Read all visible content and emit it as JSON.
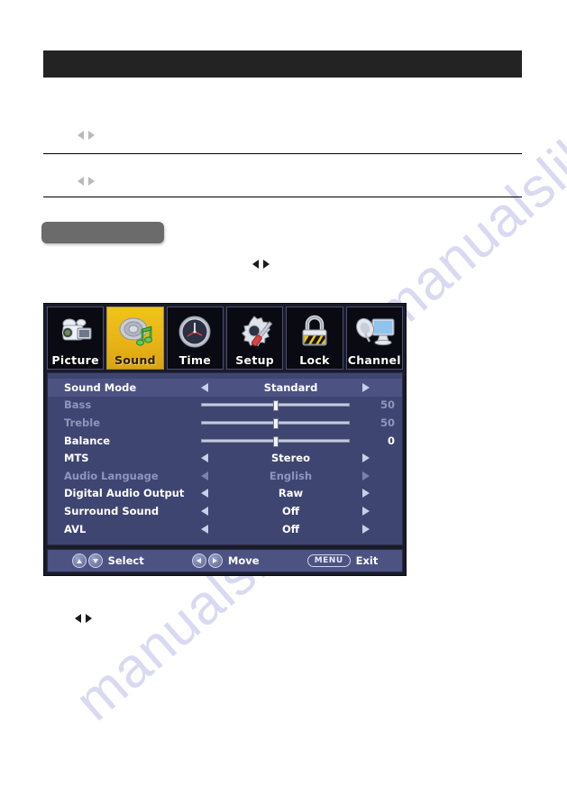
{
  "page": {
    "watermark": "manualslib.com"
  },
  "document_blanks": {
    "header_bar": "",
    "field_row_1": "",
    "field_row_2": "",
    "gray_button": "",
    "arrow_pair_glyph": "◀ ▶"
  },
  "osd": {
    "tabs": [
      {
        "label": "Picture",
        "icon": "camcorder-icon",
        "selected": false
      },
      {
        "label": "Sound",
        "icon": "speaker-music-note-icon",
        "selected": true
      },
      {
        "label": "Time",
        "icon": "clock-icon",
        "selected": false
      },
      {
        "label": "Setup",
        "icon": "gear-screwdriver-icon",
        "selected": false
      },
      {
        "label": "Lock",
        "icon": "padlock-icon",
        "selected": false
      },
      {
        "label": "Channel",
        "icon": "satellite-monitor-icon",
        "selected": false
      }
    ],
    "rows": [
      {
        "label": "Sound Mode",
        "type": "option",
        "value": "Standard",
        "enabled": true,
        "highlighted": true
      },
      {
        "label": "Bass",
        "type": "slider",
        "value": "50",
        "percent": 50,
        "enabled": false,
        "highlighted": false
      },
      {
        "label": "Treble",
        "type": "slider",
        "value": "50",
        "percent": 50,
        "enabled": false,
        "highlighted": false
      },
      {
        "label": "Balance",
        "type": "slider",
        "value": "0",
        "percent": 50,
        "enabled": true,
        "highlighted": false
      },
      {
        "label": "MTS",
        "type": "option",
        "value": "Stereo",
        "enabled": true,
        "highlighted": false
      },
      {
        "label": "Audio Language",
        "type": "option",
        "value": "English",
        "enabled": false,
        "highlighted": false
      },
      {
        "label": "Digital Audio Output",
        "type": "option",
        "value": "Raw",
        "enabled": true,
        "highlighted": false
      },
      {
        "label": "Surround Sound",
        "type": "option",
        "value": "Off",
        "enabled": true,
        "highlighted": false
      },
      {
        "label": "AVL",
        "type": "option",
        "value": "Off",
        "enabled": true,
        "highlighted": false
      }
    ],
    "footer": {
      "select_label": "Select",
      "move_label": "Move",
      "menu_key_label": "MENU",
      "exit_label": "Exit"
    },
    "colors": {
      "selected_tab": "#e8b417",
      "panel_bg": "#3e4570",
      "highlight_row": "#4c5383",
      "text": "#ffffff",
      "disabled_text": "#8f96bd"
    }
  }
}
